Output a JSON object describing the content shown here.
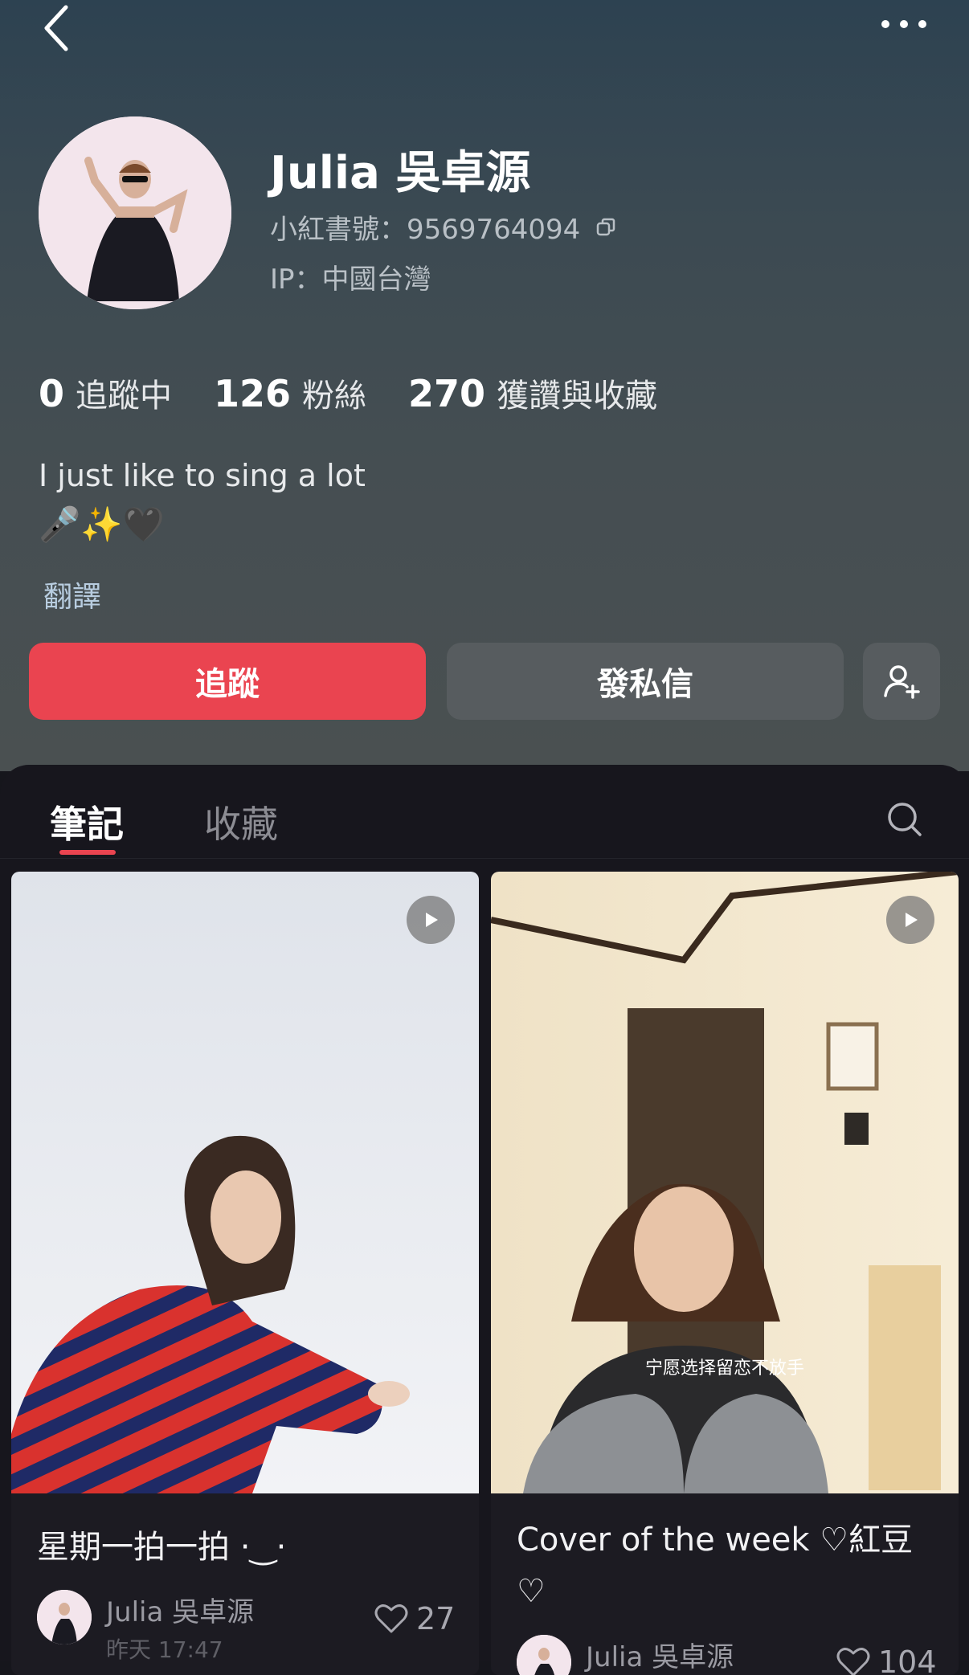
{
  "header": {
    "back_icon": "chevron-left-icon",
    "more_icon": "more-dots-icon"
  },
  "profile": {
    "name": "Julia 吳卓源",
    "id_text": "小紅書號：9569764094",
    "ip_text": "IP：中國台灣",
    "copy_icon": "copy-icon"
  },
  "stats": [
    {
      "value": "0",
      "label": "追蹤中"
    },
    {
      "value": "126",
      "label": "粉絲"
    },
    {
      "value": "270",
      "label": "獲讚與收藏"
    }
  ],
  "bio": {
    "line1": "I just like to sing a lot",
    "line2": "🎤✨🖤",
    "translate_label": "翻譯"
  },
  "actions": {
    "follow_label": "追蹤",
    "message_label": "發私信",
    "add_friend_icon": "add-user-icon"
  },
  "tabs": [
    {
      "label": "筆記",
      "active": true
    },
    {
      "label": "收藏",
      "active": false
    }
  ],
  "posts": [
    {
      "title": "星期一拍一拍 ·‿·",
      "author": "Julia 吳卓源",
      "time": "昨天 17:47",
      "likes": "27",
      "is_video": true
    },
    {
      "title_line1": "Cover of the week ♡紅豆",
      "title_line2": "♡",
      "author": "Julia 吳卓源",
      "likes": "104",
      "subtitle": "宁愿选择留恋不放手",
      "is_video": true
    }
  ],
  "colors": {
    "accent": "#ea4450",
    "button_gray": "#575c5f",
    "panel": "#17161d"
  }
}
